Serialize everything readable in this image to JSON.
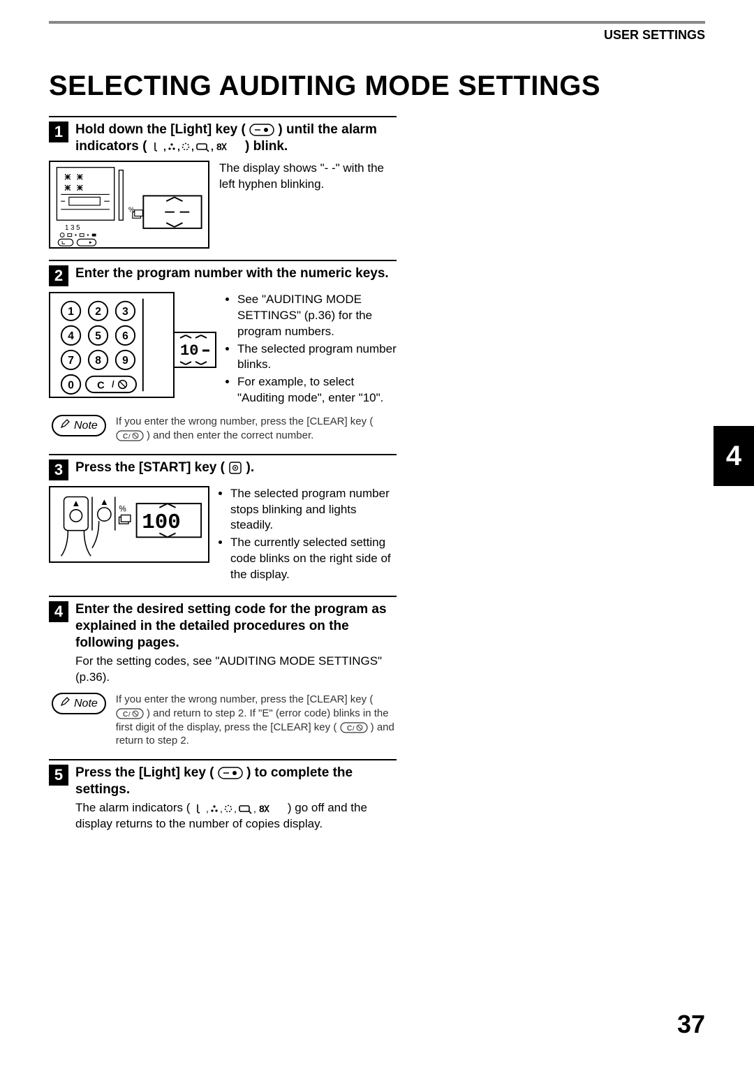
{
  "header": {
    "label": "USER SETTINGS"
  },
  "title": "SELECTING AUDITING MODE SETTINGS",
  "tab_number": "4",
  "page_number": "37",
  "steps": [
    {
      "num": "1",
      "title_parts": {
        "a": "Hold down the [Light] key (",
        "b": ") until the alarm indicators (",
        "c": ") blink."
      },
      "desc": "The display shows \"- -\" with the left hyphen blinking.",
      "seg": "- -",
      "panel_labels": {
        "line1": "1  3  5"
      }
    },
    {
      "num": "2",
      "title": "Enter the program number with the numeric keys.",
      "bullets": [
        "See \"AUDITING MODE SETTINGS\" (p.36) for the program numbers.",
        "The selected program number blinks.",
        "For example, to select \"Auditing mode\", enter \"10\"."
      ],
      "keypad": {
        "keys": [
          "1",
          "2",
          "3",
          "4",
          "5",
          "6",
          "7",
          "8",
          "9",
          "0"
        ],
        "clear": "C"
      },
      "seg": "10 -",
      "note": "If you enter the wrong number, press the [CLEAR] key (           ) and then enter the correct number."
    },
    {
      "num": "3",
      "title_parts": {
        "a": "Press the [START] key (",
        "b": ")."
      },
      "bullets": [
        "The selected program number stops blinking and lights steadily.",
        "The currently selected setting code blinks on the right side of the display."
      ],
      "seg": "100",
      "percent": "%"
    },
    {
      "num": "4",
      "title": "Enter the desired setting code for the program as explained in the detailed procedures on the following pages.",
      "sub": "For the setting codes, see \"AUDITING MODE SETTINGS\" (p.36).",
      "note": "If you enter the wrong number, press the [CLEAR] key (           ) and return to step 2. If \"E\" (error code) blinks in the first digit of the display, press the [CLEAR] key (           ) and return to step 2."
    },
    {
      "num": "5",
      "title_parts": {
        "a": "Press the [Light] key (",
        "b": ") to complete the settings."
      },
      "sub_parts": {
        "a": "The alarm indicators (",
        "b": ") go off and the display returns to the number of copies display."
      }
    }
  ],
  "note_label": "Note",
  "icons": {
    "light_key": "light-key",
    "alarm_set": "alarm-set",
    "start_key": "start-key",
    "clear_key": "clear-key",
    "pencil": "pencil"
  }
}
